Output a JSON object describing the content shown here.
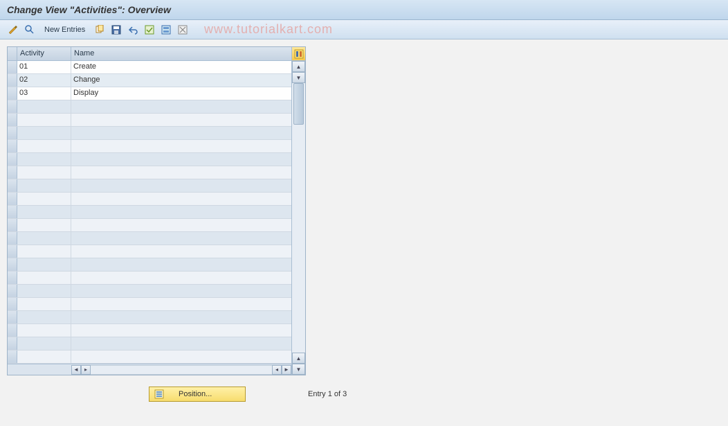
{
  "title": "Change View \"Activities\": Overview",
  "toolbar": {
    "new_entries_label": "New Entries"
  },
  "watermark": "www.tutorialkart.com",
  "table": {
    "header_activity": "Activity",
    "header_name": "Name",
    "rows": [
      {
        "activity": "01",
        "name": "Create"
      },
      {
        "activity": "02",
        "name": "Change"
      },
      {
        "activity": "03",
        "name": "Display"
      }
    ]
  },
  "footer": {
    "position_label": "Position...",
    "entry_status": "Entry 1 of 3"
  }
}
